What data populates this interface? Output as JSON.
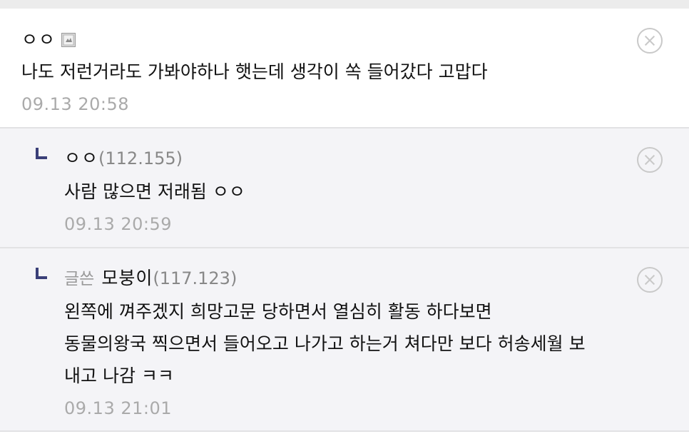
{
  "comments": [
    {
      "nickname": "ㅇㅇ",
      "member_icon": "fixed-nick-icon",
      "lines": [
        "나도 저런거라도 가봐야하나 햇는데 생각이 쏙 들어갔다 고맙다"
      ],
      "date": "09.13 20:58"
    },
    {
      "nickname": "ㅇㅇ",
      "ip": "(112.155)",
      "lines": [
        "사람 많으면 저래됨 ㅇㅇ"
      ],
      "date": "09.13 20:59"
    },
    {
      "writer_tag": "글쓴",
      "nickname": "모붕이",
      "ip": "(117.123)",
      "lines": [
        "왼쪽에 껴주겠지 희망고문 당하면서 열심히 활동 하다보면",
        "동물의왕국 찍으면서 들어오고 나가고 하는거 쳐다만 보다 허송세월 보",
        "내고 나감 ㅋㅋ"
      ],
      "date": "09.13 21:01"
    }
  ],
  "colors": {
    "reply_background": "#f4f4f7",
    "reply_arrow": "#3a3f78",
    "date_text": "#aaaaaa",
    "ip_text": "#888888"
  }
}
